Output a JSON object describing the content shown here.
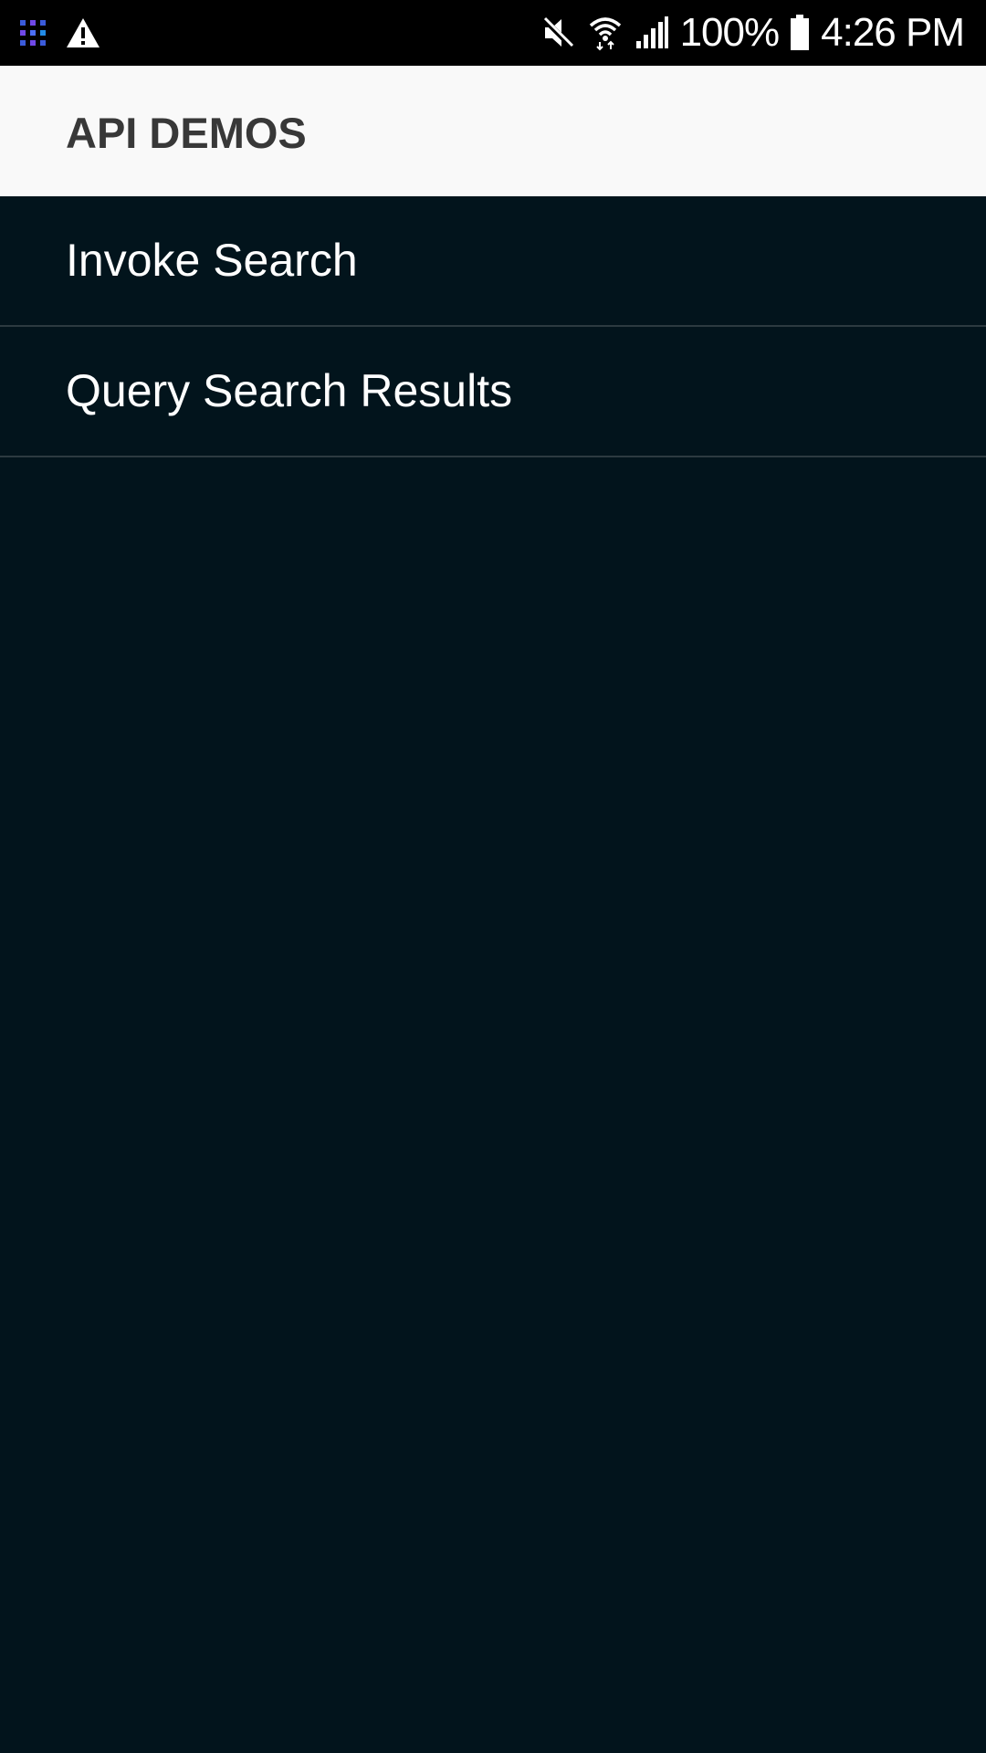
{
  "status_bar": {
    "left_icons": [
      "app-grid-icon",
      "warning-icon"
    ],
    "right_icons": [
      "mute-icon",
      "wifi-icon",
      "signal-icon",
      "battery-icon"
    ],
    "battery_text": "100%",
    "time": "4:26 PM"
  },
  "app_bar": {
    "title": "API DEMOS",
    "background": "#f9f9f9",
    "title_color": "#383838"
  },
  "list": {
    "items": [
      {
        "label": "Invoke Search"
      },
      {
        "label": "Query Search Results"
      }
    ],
    "background": "#02141c",
    "divider_color": "#2c3a40"
  }
}
